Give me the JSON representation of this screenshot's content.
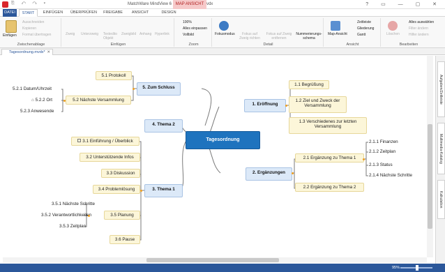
{
  "window": {
    "title": "MatchWare MindView 6 - Tagesordnung.mvdx",
    "context_tab": "MAP ANSICHT"
  },
  "tabs": [
    "DATEI",
    "START",
    "EINFÜGEN",
    "ÜBERPRÜFEN",
    "FREIGABE",
    "ANSICHT",
    "DESIGN"
  ],
  "ribbon": {
    "clipboard": {
      "label": "Zwischenablage",
      "paste": "Einfügen",
      "cut": "Ausschneiden",
      "copy": "Kopieren",
      "format": "Format übertragen"
    },
    "insert": {
      "label": "Einfügen",
      "branch": "Zweig",
      "subbranch": "Unterzweig",
      "textbox": "Textedito Objekt",
      "image": "Zweigbild",
      "attachment": "Anhang",
      "hyperlink": "Hyperlink"
    },
    "zoom": {
      "label": "Zoom",
      "p100": "100%",
      "fit": "Alles einpassen",
      "full": "Vollbild"
    },
    "detail": {
      "label": "Detail",
      "focus": "Fokusmodus",
      "focus_branch": "Fokus auf Zweig richten",
      "focus_remove": "Fokus auf Zweig entfernen",
      "numbering": "Nummerierungs-schema"
    },
    "view": {
      "label": "Ansicht",
      "map": "Map-Ansicht",
      "timeline": "Zeitleiste",
      "outline": "Gliederung",
      "gantt": "Gantt"
    },
    "edit": {
      "label": "Bearbeiten",
      "delete": "Löschen",
      "select_all": "Alles auswählen",
      "filter": "Filter ändern",
      "find": "Hilfer ändern"
    }
  },
  "document_tab": "Tagesordnung.mvdx*",
  "side_tabs": [
    "Aufgaben/Zeitleiste",
    "Multimedia-Katalog",
    "Kalkulation"
  ],
  "map": {
    "center": "Tagesordnung",
    "branches": {
      "b1": "1. Eröffnung",
      "b2": "2. Ergänzungen",
      "b3": "3. Thema 1",
      "b4": "4. Thema 2",
      "b5": "5. Zum Schluss"
    },
    "sub": {
      "s11": "1.1  Begrüßung",
      "s12a": "1.2  Ziel und Zweck der",
      "s12b": "Versammlung",
      "s13a": "1.3  Verschiedenes zur letzten",
      "s13b": "Versammlung",
      "s21": "2.1  Ergänzung zu Thema 1",
      "s22": "2.2  Ergänzung zu Thema 2",
      "s31": "3.1  Einführung / Überblick",
      "s32": "3.2  Unterstützende Infos",
      "s33": "3.3  Diskussion",
      "s34": "3.4  Problemlösung",
      "s35": "3.5  Planung",
      "s36": "3.6  Pause",
      "s51": "5.1  Protokoll",
      "s52": "5.2  Nächste Versammlung"
    },
    "leaves": {
      "l211": "2.1.1  Finanzen",
      "l212": "2.1.2  Zeitplan",
      "l213": "2.1.3  Status",
      "l214": "2.1.4  Nächste Schritte",
      "l351": "3.5.1  Nächste Schritte",
      "l352": "3.5.2  Verantwortlichkeiten",
      "l353": "3.5.3  Zeitplan",
      "l521": "5.2.1  Datum/Uhrzeit",
      "l522": "5.2.2  Ort",
      "l523": "5.2.3  Anwesende"
    }
  },
  "status": {
    "zoom": "95%"
  }
}
